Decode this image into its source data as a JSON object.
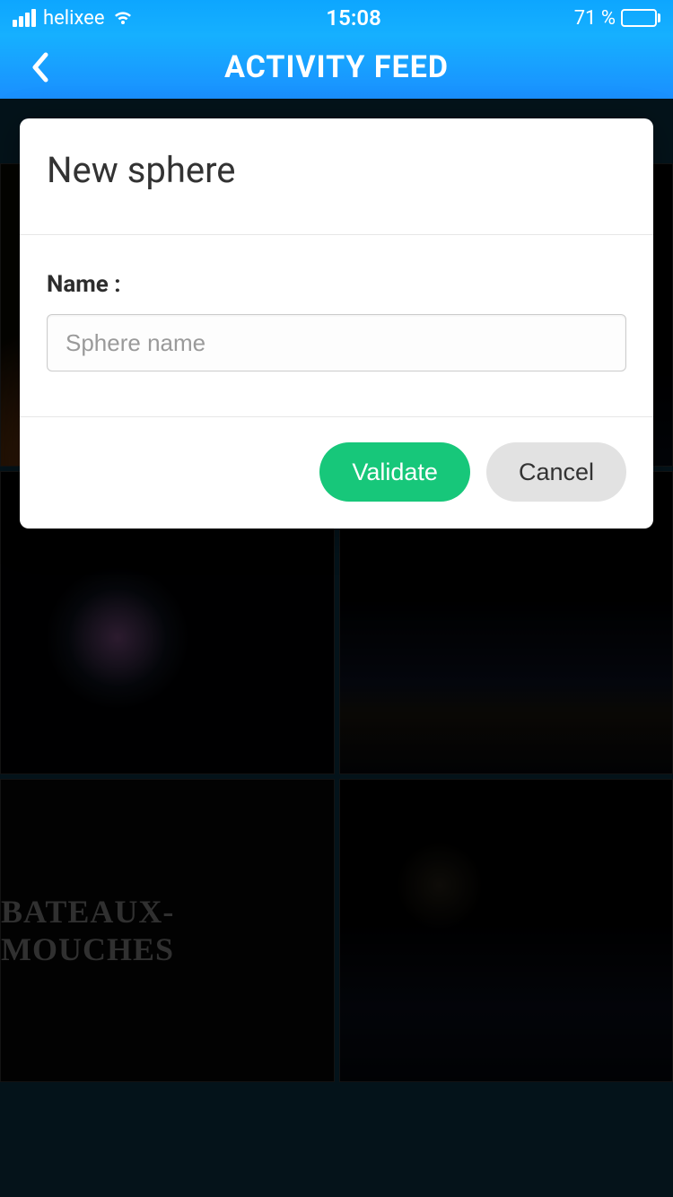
{
  "status": {
    "carrier": "helixee",
    "time": "15:08",
    "battery_text": "71 %",
    "battery_pct": 71
  },
  "nav": {
    "title": "ACTIVITY FEED"
  },
  "modal": {
    "title": "New sphere",
    "field_label": "Name :",
    "placeholder": "Sphere name",
    "value": "",
    "validate_label": "Validate",
    "cancel_label": "Cancel"
  },
  "bg_tiles": {
    "bateaux_text": "BATEAUX-MOUCHES"
  }
}
